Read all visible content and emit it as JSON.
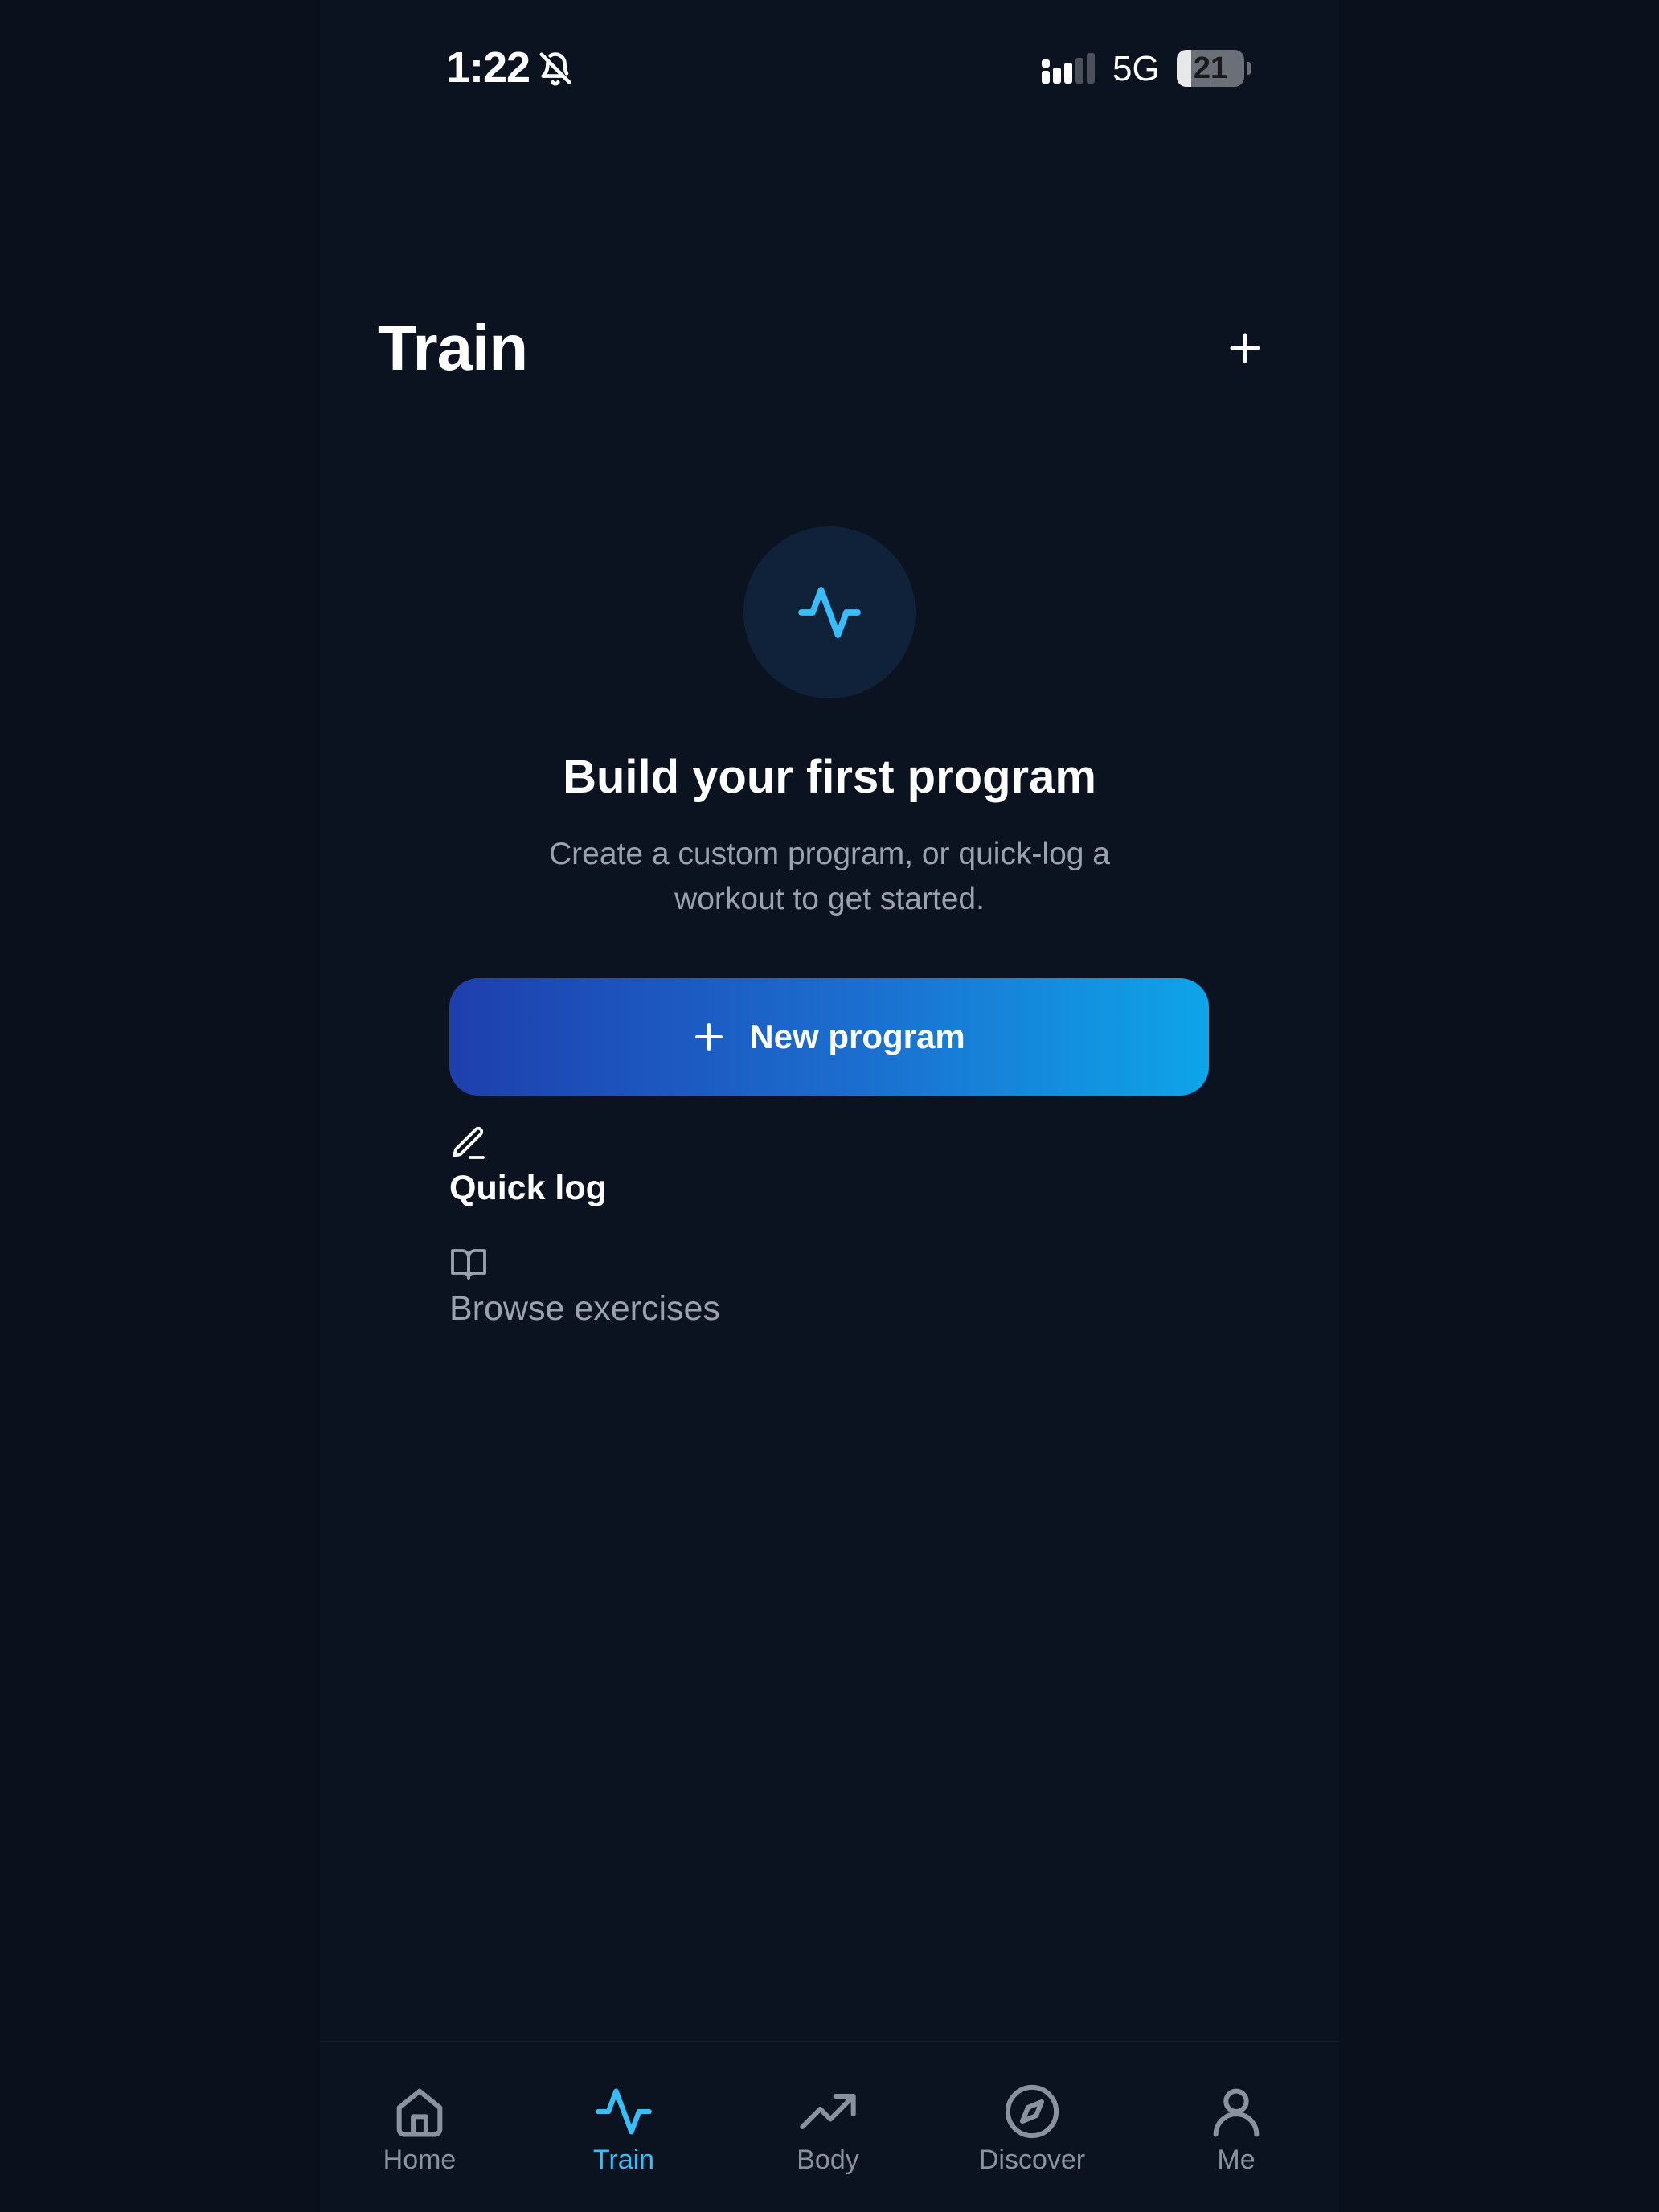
{
  "status_bar": {
    "time": "1:22",
    "network": "5G",
    "battery": "21",
    "battery_level_percent": 21,
    "icons": [
      "bell-slash-icon",
      "signal-icon"
    ]
  },
  "header": {
    "title": "Train",
    "add_icon": "plus-icon"
  },
  "empty_state": {
    "icon": "activity-pulse-icon",
    "title": "Build your first program",
    "subtitle": "Create a custom program, or quick-log a workout to get started.",
    "primary_button": {
      "label": "New program",
      "icon": "plus-icon"
    },
    "quick_log": {
      "label": "Quick log",
      "icon": "pencil-icon"
    },
    "browse": {
      "label": "Browse exercises",
      "icon": "book-open-icon"
    }
  },
  "tab_bar": {
    "items": [
      {
        "label": "Home",
        "icon": "home-icon",
        "active": false
      },
      {
        "label": "Train",
        "icon": "activity-pulse-icon",
        "active": true
      },
      {
        "label": "Body",
        "icon": "trending-up-icon",
        "active": false
      },
      {
        "label": "Discover",
        "icon": "compass-icon",
        "active": false
      },
      {
        "label": "Me",
        "icon": "user-icon",
        "active": false
      }
    ]
  },
  "colors": {
    "background": "#0b1220",
    "accent": "#38bdf8",
    "muted_text": "#9aa2b0",
    "button_gradient_start": "#1e3fae",
    "button_gradient_end": "#0ea5e9"
  }
}
